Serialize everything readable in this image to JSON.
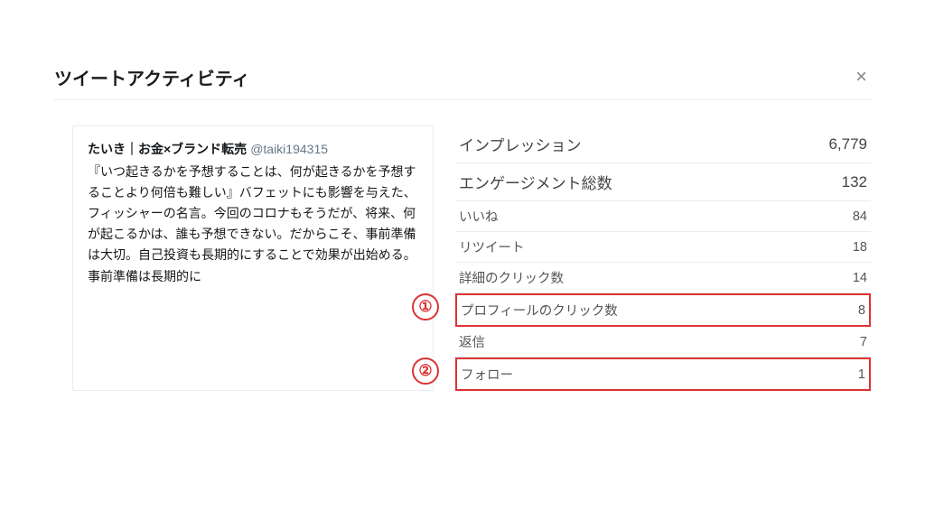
{
  "header": {
    "title": "ツイートアクティビティ",
    "close_label": "×"
  },
  "tweet": {
    "author": "たいき｜お金×ブランド転売",
    "handle": "@taiki194315",
    "text": "『いつ起きるかを予想することは、何が起きるかを予想することより何倍も難しい』バフェットにも影響を与えた、フィッシャーの名言。今回のコロナもそうだが、将来、何が起こるかは、誰も予想できない。だからこそ、事前準備は大切。自己投資も長期的にすることで効果が出始める。事前準備は長期的に"
  },
  "stats": {
    "impressions": {
      "label": "インプレッション",
      "value": "6,779"
    },
    "engagements": {
      "label": "エンゲージメント総数",
      "value": "132"
    },
    "likes": {
      "label": "いいね",
      "value": "84"
    },
    "retweets": {
      "label": "リツイート",
      "value": "18"
    },
    "detail_clicks": {
      "label": "詳細のクリック数",
      "value": "14"
    },
    "profile_clicks": {
      "label": "プロフィールのクリック数",
      "value": "8"
    },
    "replies": {
      "label": "返信",
      "value": "7"
    },
    "follows": {
      "label": "フォロー",
      "value": "1"
    }
  },
  "annotations": {
    "badge1": "①",
    "badge2": "②"
  }
}
